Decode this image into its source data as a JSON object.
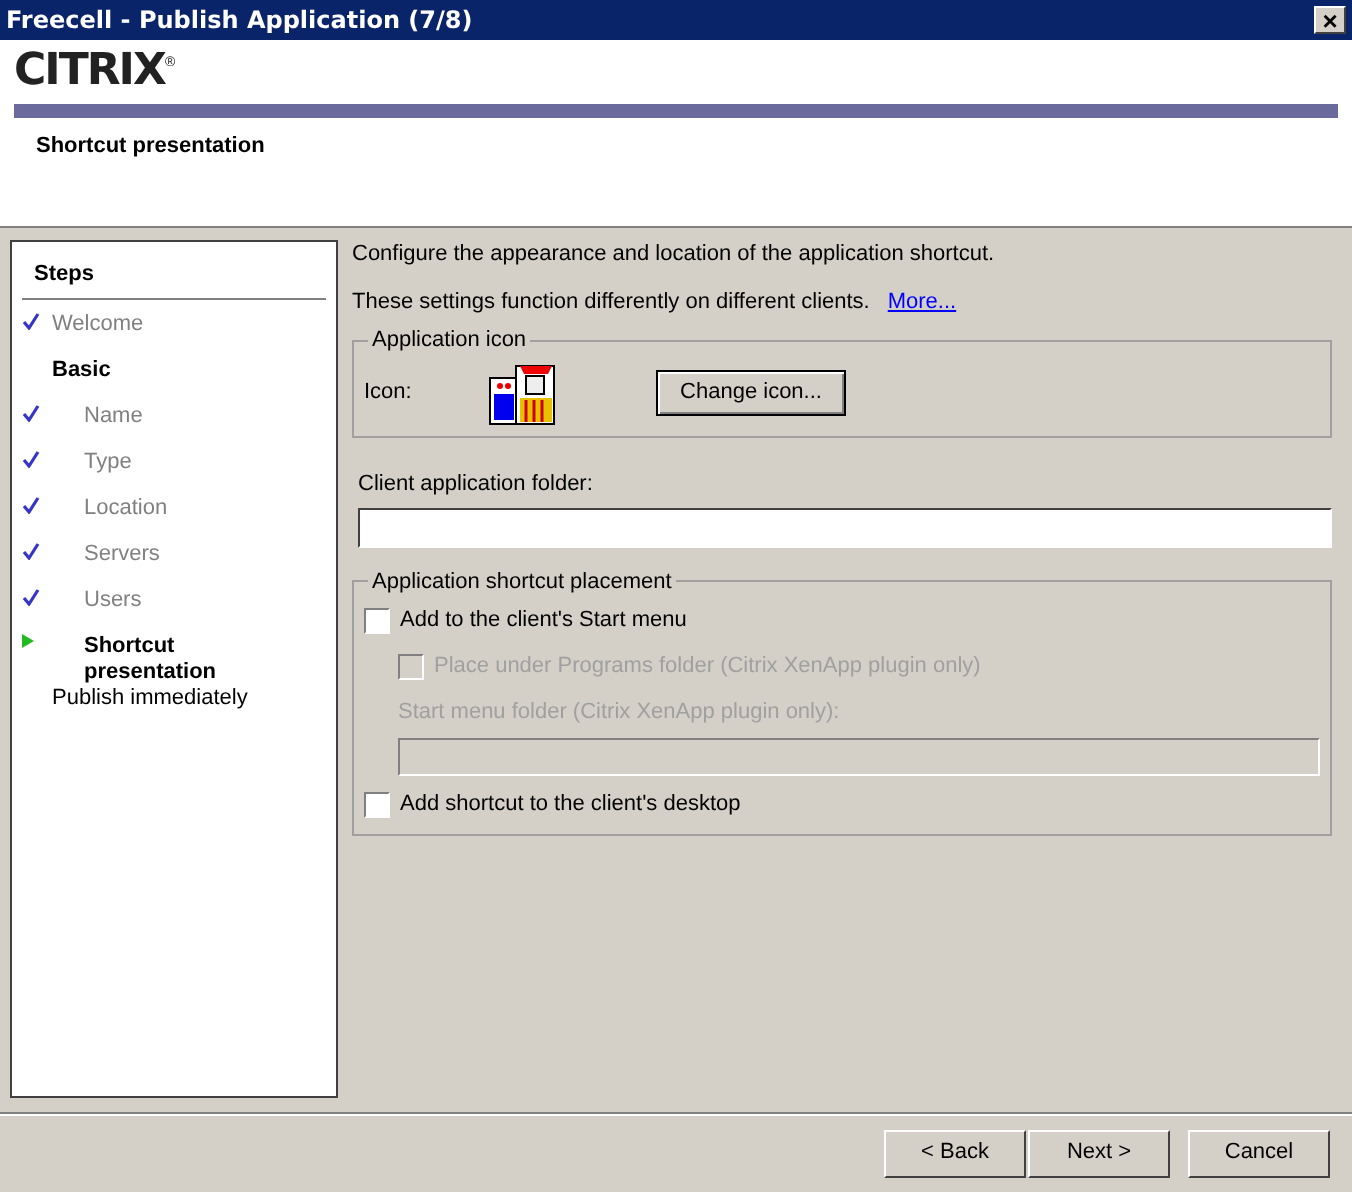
{
  "window": {
    "title": "Freecell - Publish Application (7/8)",
    "close": "×"
  },
  "header": {
    "logo": "CITRIX",
    "logo_mark": "®",
    "page_title": "Shortcut presentation"
  },
  "steps": {
    "title": "Steps",
    "items": [
      {
        "kind": "step",
        "label": "Welcome",
        "completed": true,
        "selected": false
      },
      {
        "kind": "group",
        "label": "Basic",
        "children": [
          {
            "kind": "step",
            "label": "Name",
            "completed": true,
            "selected": false
          },
          {
            "kind": "step",
            "label": "Type",
            "completed": true,
            "selected": false
          },
          {
            "kind": "step",
            "label": "Location",
            "completed": true,
            "selected": false
          },
          {
            "kind": "step",
            "label": "Servers",
            "completed": true,
            "selected": false
          },
          {
            "kind": "step",
            "label": "Users",
            "completed": true,
            "selected": false
          },
          {
            "kind": "step",
            "label": "Shortcut presentation",
            "completed": false,
            "selected": true
          }
        ]
      },
      {
        "kind": "step",
        "label": "Publish immediately",
        "completed": false,
        "selected": false
      }
    ]
  },
  "content": {
    "intro": "Configure the appearance and location of the application shortcut.",
    "note": "These settings function differently on different clients.",
    "note_link": "More...",
    "icon_group": {
      "legend": "Application icon",
      "label": "Icon:",
      "button": "Change icon..."
    },
    "folder": {
      "label": "Client application folder:"
    },
    "placement": {
      "legend": "Application shortcut placement",
      "options": [
        {
          "kind": "checkbox",
          "label": "Add to the client's Start menu",
          "checked": false,
          "disabled": false
        },
        {
          "kind": "sub_checkbox",
          "label": "Place under Programs folder (Citrix XenApp plugin only)",
          "checked": false,
          "disabled": true
        },
        {
          "kind": "sub_field",
          "label": "Start menu folder (Citrix XenApp plugin only):",
          "disabled": true
        },
        {
          "kind": "checkbox",
          "label": "Add shortcut to the client's desktop",
          "checked": false,
          "disabled": false
        }
      ]
    }
  },
  "buttons": [
    {
      "label": "< Back",
      "kind": "back"
    },
    {
      "label": "Next >",
      "kind": "next"
    },
    {
      "label": "Cancel",
      "kind": "cancel"
    }
  ]
}
